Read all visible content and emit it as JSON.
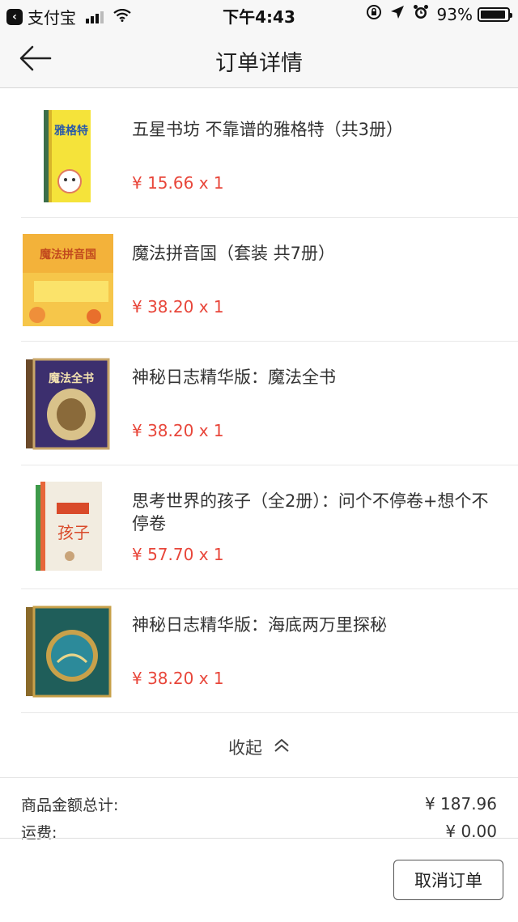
{
  "status_bar": {
    "carrier": "支付宝",
    "time": "下午4:43",
    "battery": "93%",
    "battery_level": 0.93,
    "icons": [
      "back-to-app-icon",
      "signal-icon",
      "wifi-icon",
      "rotation-lock-icon",
      "location-icon",
      "alarm-icon",
      "battery-icon"
    ]
  },
  "nav": {
    "title": "订单详情",
    "back_icon": "back-arrow-icon"
  },
  "products": [
    {
      "title": "五星书坊 不靠谱的雅格特（共3册）",
      "price": "¥ 15.66 x 1",
      "cover_text": "雅格特"
    },
    {
      "title": "魔法拼音国（套装 共7册）",
      "price": "¥ 38.20 x 1",
      "cover_text": "魔法拼音国"
    },
    {
      "title": "神秘日志精华版：魔法全书",
      "price": "¥ 38.20 x 1",
      "cover_text": "魔法全书"
    },
    {
      "title": "思考世界的孩子（全2册）：问个不停卷+想个不停卷",
      "price": "¥ 57.70 x 1",
      "cover_text": "孩子"
    },
    {
      "title": "神秘日志精华版：海底两万里探秘",
      "price": "¥ 38.20 x 1",
      "cover_text": ""
    }
  ],
  "collapse": {
    "label": "收起",
    "icon": "chevron-up-icon"
  },
  "summary": {
    "items_total_label": "商品金额总计:",
    "items_total_value": "¥ 187.96",
    "shipping_label": "运费:",
    "shipping_value": "¥ 0.00"
  },
  "actions": {
    "cancel_label": "取消订单"
  },
  "colors": {
    "price": "#e8463a",
    "nav_bg": "#f7f7f7"
  }
}
